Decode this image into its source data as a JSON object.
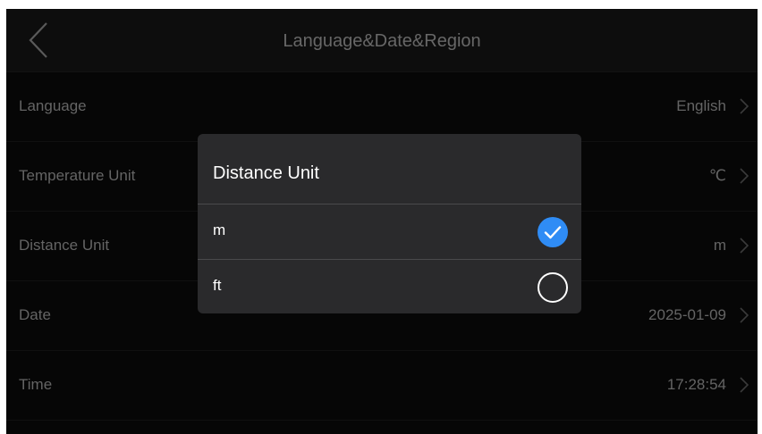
{
  "header": {
    "title": "Language&Date&Region"
  },
  "settings": [
    {
      "label": "Language",
      "value": "English"
    },
    {
      "label": "Temperature Unit",
      "value": "℃"
    },
    {
      "label": "Distance Unit",
      "value": "m"
    },
    {
      "label": "Date",
      "value": "2025-01-09"
    },
    {
      "label": "Time",
      "value": "17:28:54"
    }
  ],
  "dialog": {
    "title": "Distance Unit",
    "options": [
      {
        "label": "m",
        "selected": true
      },
      {
        "label": "ft",
        "selected": false
      }
    ]
  },
  "colors": {
    "accent": "#2f8cf5",
    "background": "#0a0a0a",
    "dialog_background": "#2a2a2c"
  },
  "icons": [
    "chevron-left-icon",
    "chevron-right-icon",
    "check-circle-icon",
    "radio-empty-icon"
  ]
}
